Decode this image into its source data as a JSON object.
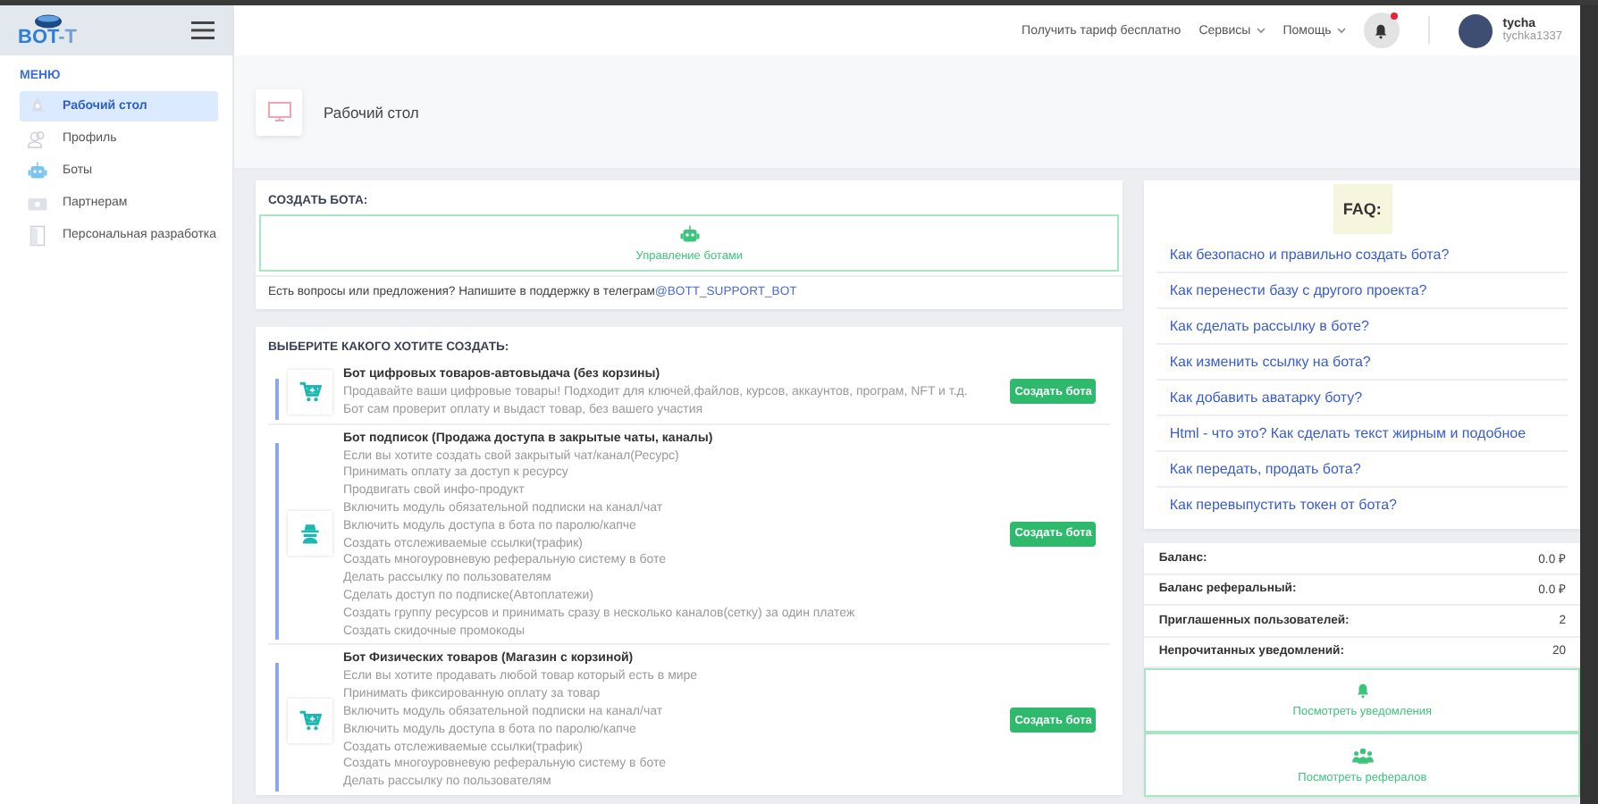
{
  "sidebar": {
    "logo_main": "BOT",
    "logo_suffix": "-T",
    "menu_title": "МЕНЮ",
    "items": [
      {
        "kind": "dashboard",
        "label": "Рабочий стол",
        "selected": true
      },
      {
        "kind": "profile",
        "label": "Профиль",
        "selected": false
      },
      {
        "kind": "bots",
        "label": "Боты",
        "selected": false
      },
      {
        "kind": "partners",
        "label": "Партнерам",
        "selected": false
      },
      {
        "kind": "development",
        "label": "Персональная разработка",
        "selected": false
      }
    ]
  },
  "topbar": {
    "links": [
      {
        "label": "Получить тариф бесплатно",
        "dropdown": false
      },
      {
        "label": "Сервисы",
        "dropdown": true
      },
      {
        "label": "Помощь",
        "dropdown": true
      }
    ],
    "notifications": {
      "unread": true
    },
    "user": {
      "name": "tycha",
      "handle": "tychka1337"
    }
  },
  "page_header": {
    "title": "Рабочий стол"
  },
  "create_bot": {
    "title": "СОЗДАТЬ БОТА:",
    "manage_button": "Управление ботами",
    "support_text": "Есть вопросы или предложения? Напишите в поддержку в телеграм",
    "support_link": "@BOTT_SUPPORT_BOT"
  },
  "bot_types": {
    "title": "ВЫБЕРИТЕ КАКОГО ХОТИТЕ СОЗДАТЬ:",
    "items": [
      {
        "kind": "cart",
        "title": "Бот цифровых товаров-автовыдача (без корзины)",
        "lines": [
          "Продавайте ваши цифровые товары! Подходит для ключей,файлов, курсов, аккаунтов, програм, NFT и т.д. Бот сам проверит оплату и выдаст товар, без вашего участия"
        ],
        "button": "Создать бота"
      },
      {
        "kind": "subscription",
        "title": "Бот подписок (Продажа доступа в закрытые чаты, каналы)",
        "lines": [
          "Если вы хотите создать свой закрытый чат/канал(Ресурс)",
          "Принимать оплату за доступ к ресурсу",
          "Продвигать свой инфо-продукт",
          "Включить модуль обязательной подписки на канал/чат",
          "Включить модуль доступа в бота по паролю/капче",
          "Создать отслеживаемые ссылки(трафик)",
          "Создать многоуровневую реферальную систему в боте",
          "Делать рассылку по пользователям",
          "Сделать доступ по подписке(Автоплатежи)",
          "Создать группу ресурсов и принимать сразу в несколько каналов(сетку) за один платеж",
          "Создать скидочные промокоды"
        ],
        "button": "Создать бота"
      },
      {
        "kind": "cart",
        "title": "Бот Физических товаров (Магазин с корзиной)",
        "lines": [
          "Если вы хотите продавать любой товар который есть в мире",
          "Принимать фиксированную оплату за товар",
          "Включить модуль обязательной подписки на канал/чат",
          "Включить модуль доступа в бота по паролю/капче",
          "Создать отслеживаемые ссылки(трафик)",
          "Создать многоуровневую реферальную систему в боте",
          "Делать рассылку по пользователям"
        ],
        "button": "Создать бота"
      }
    ]
  },
  "faq": {
    "title": "FAQ:",
    "items": [
      "Как безопасно и правильно создать бота?",
      "Как перенести базу с другого проекта?",
      "Как сделать рассылку в боте?",
      "Как изменить ссылку на бота?",
      "Как добавить аватарку боту?",
      "Html - что это? Как сделать текст жирным и подобное",
      "Как передать, продать бота?",
      "Как перевыпустить токен от бота?"
    ]
  },
  "stats": {
    "rows": [
      {
        "label": "Баланс:",
        "value": "0.0 ₽"
      },
      {
        "label": "Баланс реферальный:",
        "value": "0.0 ₽"
      },
      {
        "label": "Приглашенных пользователей:",
        "value": "2"
      },
      {
        "label": "Непрочитанных уведомлений:",
        "value": "20"
      }
    ],
    "actions": [
      {
        "kind": "bell",
        "label": "Посмотреть уведомления"
      },
      {
        "kind": "users",
        "label": "Посмотреть рефералов"
      }
    ]
  }
}
